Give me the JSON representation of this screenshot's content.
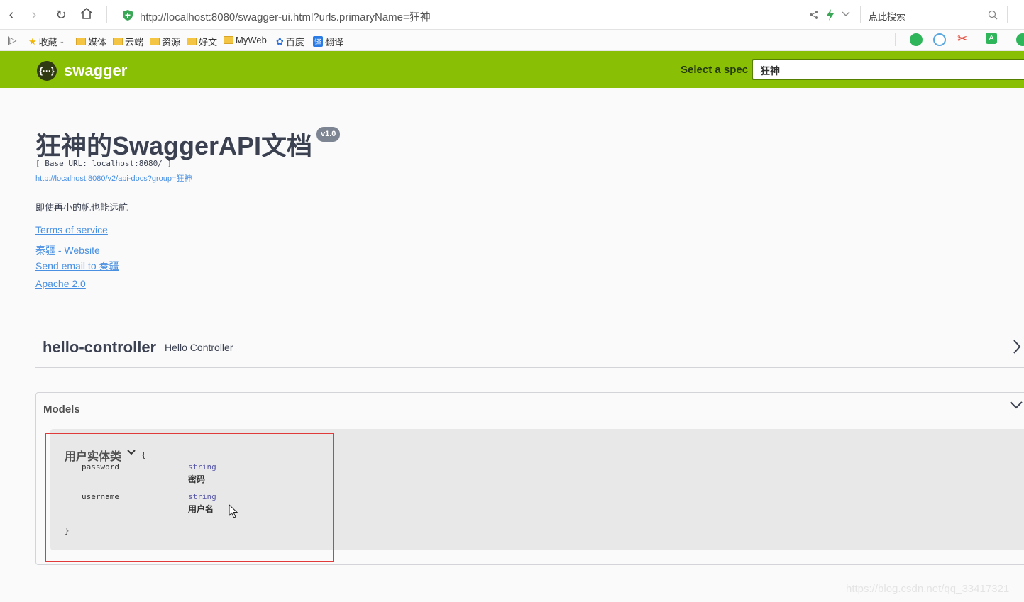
{
  "browser": {
    "url": "http://localhost:8080/swagger-ui.html?urls.primaryName=狂神",
    "search_placeholder": "点此搜索",
    "bookmarks": [
      "收藏",
      "媒体",
      "云端",
      "资源",
      "好文",
      "MyWeb",
      "百度",
      "翻译"
    ]
  },
  "header": {
    "logo": "swagger",
    "spec_label": "Select a spec",
    "spec_value": "狂神"
  },
  "info": {
    "title": "狂神的SwaggerAPI文档",
    "version": "v1.0",
    "base_url": "[ Base URL: localhost:8080/ ]",
    "docs_url": "http://localhost:8080/v2/api-docs?group=狂神",
    "description": "即使再小的帆也能远航",
    "terms": "Terms of service",
    "website": "秦疆 - Website",
    "email": "Send email to 秦疆",
    "license": "Apache 2.0"
  },
  "tag": {
    "name": "hello-controller",
    "description": "Hello Controller"
  },
  "models": {
    "title": "Models",
    "model": {
      "name": "用户实体类",
      "open_brace": "{",
      "close_brace": "}",
      "properties": [
        {
          "name": "password",
          "type": "string",
          "description": "密码"
        },
        {
          "name": "username",
          "type": "string",
          "description": "用户名"
        }
      ]
    }
  },
  "watermark": "https://blog.csdn.net/qq_33417321",
  "colors": {
    "swagger_green": "#89bf04",
    "link": "#4990e2",
    "highlight": "#e03a3a"
  }
}
